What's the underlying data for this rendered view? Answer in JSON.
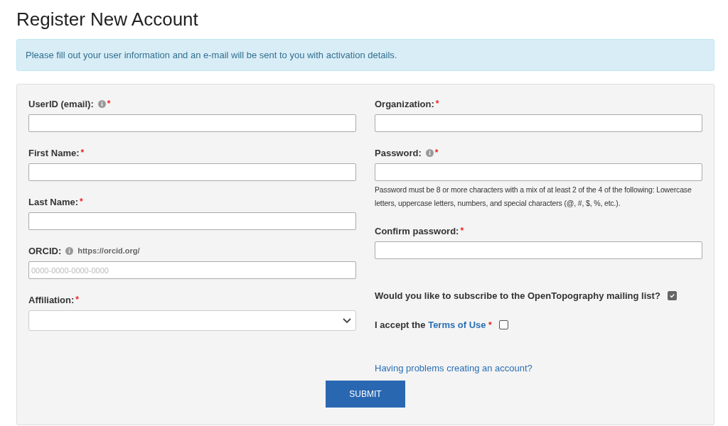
{
  "title": "Register New Account",
  "notice": "Please fill out your user information and an e-mail will be sent to you with activation details.",
  "left_fields": [
    {
      "kind": "text",
      "label": "UserID (email):",
      "info": true,
      "required_mark": "*"
    },
    {
      "kind": "text",
      "label": "First Name:",
      "info": false,
      "required_mark": "*"
    },
    {
      "kind": "text",
      "label": "Last Name:",
      "info": false,
      "required_mark": "*"
    },
    {
      "kind": "text",
      "label": "ORCID:",
      "info": true,
      "hint": "https://orcid.org/",
      "placeholder": "0000-0000-0000-0000"
    },
    {
      "kind": "select",
      "label": "Affiliation:",
      "info": false,
      "required_mark": "*"
    }
  ],
  "right_fields": [
    {
      "kind": "text",
      "label": "Organization:",
      "info": false,
      "required_mark": "*"
    },
    {
      "kind": "text",
      "label": "Password:",
      "info": true,
      "required_mark": "*",
      "help": "Password must be 8 or more characters with a mix of at least 2 of the 4 of the following: Lowercase letters, uppercase letters, numbers, and special characters (@, #, $, %, etc.)."
    },
    {
      "kind": "text",
      "label": "Confirm password:",
      "info": false,
      "required_mark": "*"
    }
  ],
  "checkboxes": [
    {
      "label": "Would you like to subscribe to the OpenTopography mailing list?",
      "checked": true
    },
    {
      "label": "I accept the",
      "link": "Terms of Use",
      "required_mark": "*",
      "checked": false
    }
  ],
  "help_link": "Having problems creating an account?",
  "submit": "SUBMIT"
}
